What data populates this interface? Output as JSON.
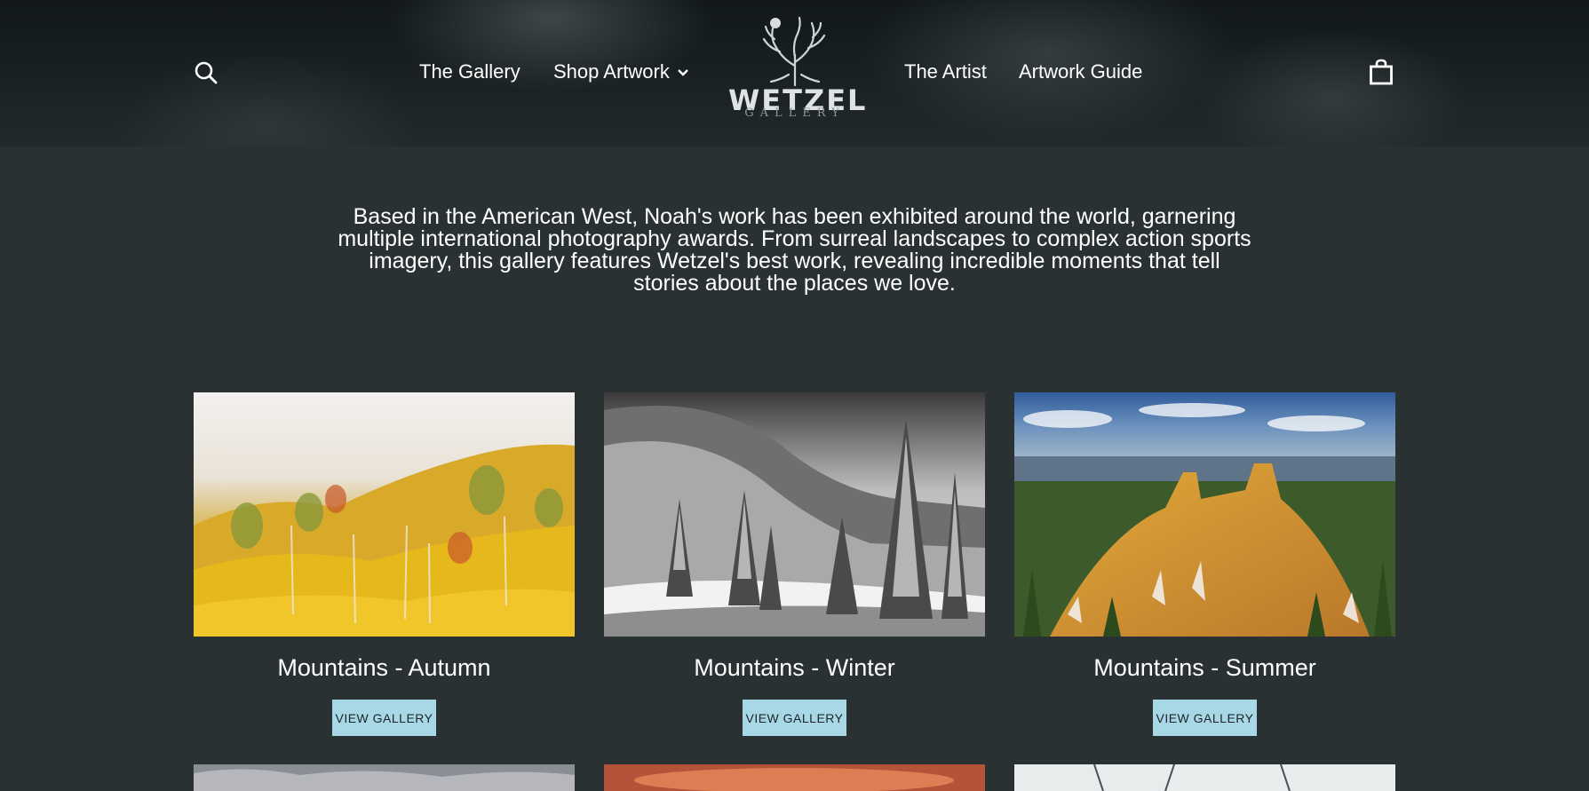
{
  "nav": {
    "search_icon": "search-icon",
    "links": [
      {
        "label": "The Gallery"
      },
      {
        "label": "Shop Artwork",
        "has_dropdown": true
      },
      {
        "label": "The Artist"
      },
      {
        "label": "Artwork Guide"
      }
    ],
    "logo": {
      "word": "WETZEL",
      "sub": "GALLERY"
    },
    "cart_icon": "cart-icon"
  },
  "intro": {
    "text": "Based in the American West, Noah's work has been exhibited around the world, garnering multiple international photography awards. From surreal landscapes to complex action sports imagery, this gallery features Wetzel's best work, revealing incredible moments that tell stories about the places we love."
  },
  "galleries": [
    {
      "title": "Mountains - Autumn",
      "button": "VIEW GALLERY"
    },
    {
      "title": "Mountains - Winter",
      "button": "VIEW GALLERY"
    },
    {
      "title": "Mountains - Summer",
      "button": "VIEW GALLERY"
    }
  ],
  "colors": {
    "background": "#2a3133",
    "header": "#161c1e",
    "button": "#a8d8e6",
    "button_text": "#1c2426",
    "text": "#ffffff"
  }
}
